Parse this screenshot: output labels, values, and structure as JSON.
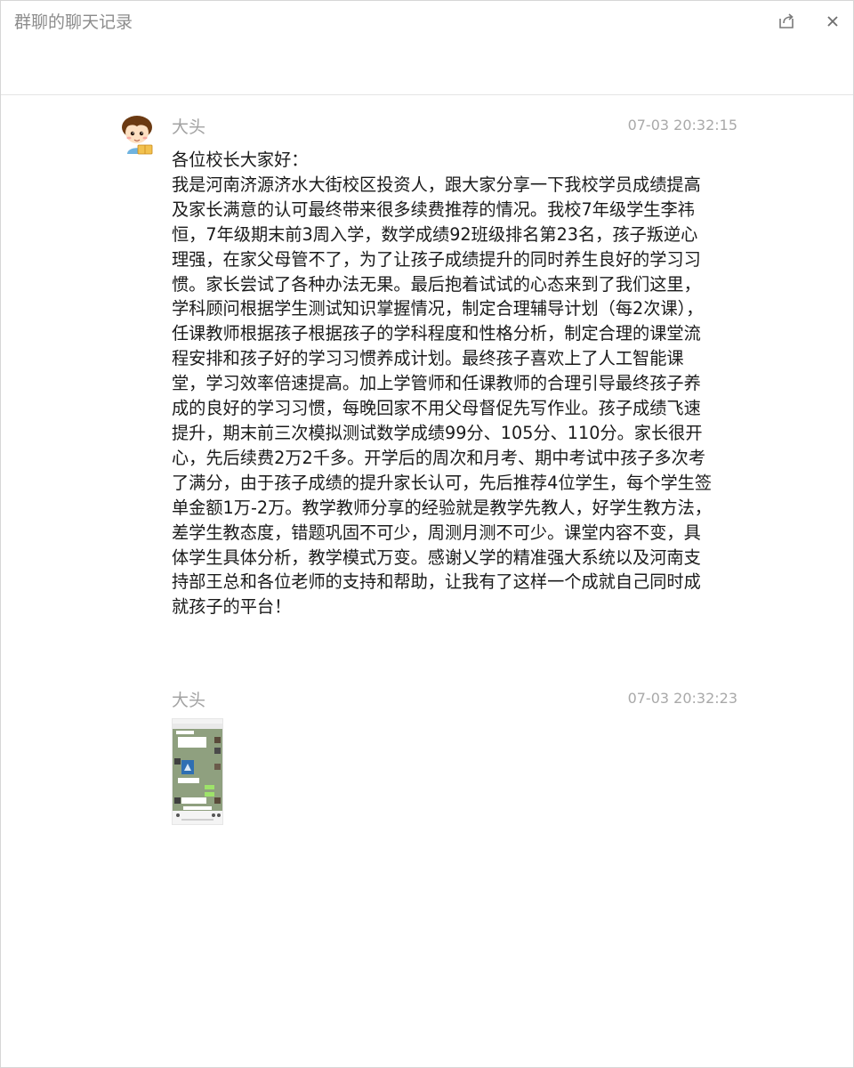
{
  "window": {
    "title": "群聊的聊天记录",
    "share_icon": "share-icon",
    "close_icon": "close-icon"
  },
  "messages": [
    {
      "sender": "大头",
      "time": "07-03 20:32:15",
      "avatar_icon": "cartoon-boy-avatar",
      "text": "各位校长大家好：\n我是河南济源济水大街校区投资人，跟大家分享一下我校学员成绩提高及家长满意的认可最终带来很多续费推荐的情况。我校7年级学生李祎恒，7年级期末前3周入学，数学成绩92班级排名第23名，孩子叛逆心理强，在家父母管不了，为了让孩子成绩提升的同时养生良好的学习习惯。家长尝试了各种办法无果。最后抱着试试的心态来到了我们这里，学科顾问根据学生测试知识掌握情况，制定合理辅导计划（每2次课），任课教师根据孩子根据孩子的学科程度和性格分析，制定合理的课堂流程安排和孩子好的学习习惯养成计划。最终孩子喜欢上了人工智能课堂，学习效率倍速提高。加上学管师和任课教师的合理引导最终孩子养成的良好的学习习惯，每晚回家不用父母督促先写作业。孩子成绩飞速提升，期末前三次模拟测试数学成绩99分、105分、110分。家长很开心，先后续费2万2千多。开学后的周次和月考、期中考试中孩子多次考了满分，由于孩子成绩的提升家长认可，先后推荐4位学生，每个学生签单金额1万-2万。教学教师分享的经验就是教学先教人，好学生教方法，差学生教态度，错题巩固不可少，周测月测不可少。课堂内容不变，具体学生具体分析，教学模式万变。感谢乂学的精准强大系统以及河南支持部王总和各位老师的支持和帮助，让我有了这样一个成就自己同时成就孩子的平台！"
    },
    {
      "sender": "大头",
      "time": "07-03 20:32:23",
      "image_icon": "chat-screenshot-thumbnail"
    }
  ],
  "colors": {
    "title": "#8c8c8c",
    "sender": "#a3a3a3",
    "time": "#a9a9a9",
    "body": "#1a1a1a",
    "divider": "#e4e4e4"
  }
}
